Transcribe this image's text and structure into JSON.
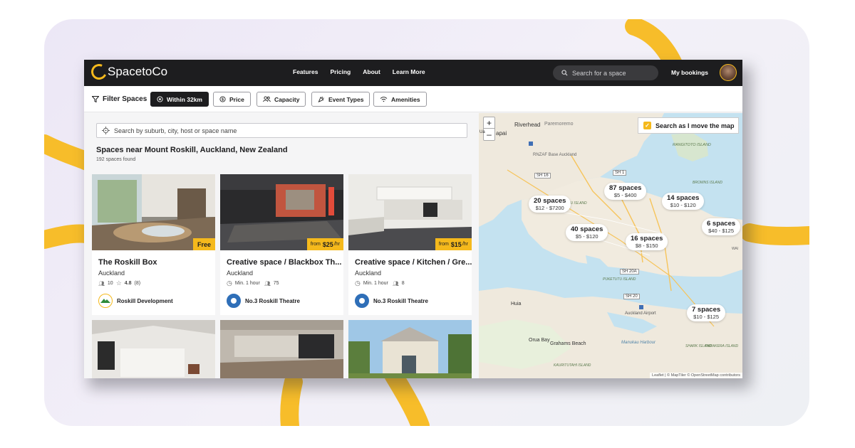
{
  "brand": {
    "name": "SpacetoCo",
    "accent": "#f5b91c"
  },
  "nav": {
    "items": [
      "Features",
      "Pricing",
      "About",
      "Learn More"
    ]
  },
  "header": {
    "search_placeholder": "Search for a space",
    "bookings": "My bookings"
  },
  "filters": {
    "title": "Filter Spaces",
    "chips": [
      "Within 32km",
      "Price",
      "Capacity",
      "Event Types",
      "Amenities"
    ]
  },
  "list": {
    "search_placeholder": "Search by suburb, city, host or space name",
    "title": "Spaces near Mount Roskill, Auckland, New Zealand",
    "count": "192 spaces found",
    "cards": [
      {
        "title": "The Roskill Box",
        "city": "Auckland",
        "capacity": "10",
        "rating": "4.8",
        "reviews": "(8)",
        "badge": "Free",
        "host": "Roskill Development"
      },
      {
        "title": "Creative space / Blackbox Th...",
        "city": "Auckland",
        "min": "Min. 1 hour",
        "capacity": "75",
        "badge_prefix": "from",
        "badge_price": "$25",
        "badge_suffix": "/hr",
        "host": "No.3 Roskill Theatre"
      },
      {
        "title": "Creative space / Kitchen / Gre...",
        "city": "Auckland",
        "min": "Min. 1 hour",
        "capacity": "8",
        "badge_prefix": "from",
        "badge_price": "$15",
        "badge_suffix": "/hr",
        "host": "No.3 Roskill Theatre"
      }
    ]
  },
  "map": {
    "search_as_move": "Search as I move the map",
    "zoom_in": "+",
    "zoom_out": "–",
    "clusters": [
      {
        "count": "20 spaces",
        "price": "$12 - $7200"
      },
      {
        "count": "87 spaces",
        "price": "$5 - $400"
      },
      {
        "count": "14 spaces",
        "price": "$10 - $120"
      },
      {
        "count": "6 spaces",
        "price": "$40 - $125"
      },
      {
        "count": "40 spaces",
        "price": "$5 - $120"
      },
      {
        "count": "16 spaces",
        "price": "$8 - $150"
      },
      {
        "count": "7 spaces",
        "price": "$10 - $125"
      }
    ],
    "labels": [
      "Riverhead",
      "Paremoremo",
      "RNZAF Base Auckland",
      "SH 16",
      "SH 1",
      "RANGITOTO ISLAND",
      "Huia",
      "Orua Bay",
      "Grahams Beach",
      "SH 20A",
      "SH 20",
      "Auckland Airport",
      "PURAKAU ISLAND",
      "KAURITUTAHI ISLAND",
      "PUKETUTU ISLAND",
      "BROWNS ISLAND",
      "Manukau Harbour",
      "Ua",
      "apai",
      "WAI",
      "SHARK ISLAND",
      "PARAKERA ISLAND"
    ],
    "attribution": "Leaflet | © MapTiler © OpenStreetMap contributors"
  }
}
